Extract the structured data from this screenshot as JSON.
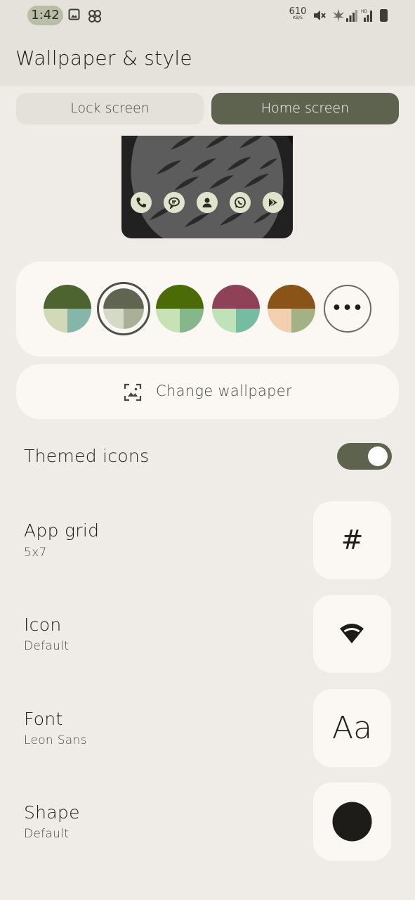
{
  "status_bar": {
    "time": "1:42",
    "net_speed_value": "610",
    "net_speed_unit": "KB/S",
    "icons": [
      "image-icon",
      "pinwheel-icon",
      "mute-icon",
      "cannabis-icon",
      "signal-icon",
      "hd-signal-icon",
      "battery-icon"
    ]
  },
  "header": {
    "title": "Wallpaper & style"
  },
  "tabs": [
    {
      "label": "Lock screen",
      "selected": false
    },
    {
      "label": "Home screen",
      "selected": true
    }
  ],
  "preview": {
    "dock_icons": [
      "phone-icon",
      "messages-icon",
      "contacts-icon",
      "whatsapp-icon",
      "play-store-icon"
    ]
  },
  "color_options": [
    {
      "top": "#4e6430",
      "bottom_left": "#d2d9b9",
      "bottom_right": "#86b5aa",
      "selected": false
    },
    {
      "top": "#5f6550",
      "bottom_left": "#d6d9c8",
      "bottom_right": "#a9b098",
      "selected": true
    },
    {
      "top": "#4a6b07",
      "bottom_left": "#c8e2b6",
      "bottom_right": "#86b78c",
      "selected": false
    },
    {
      "top": "#8f4257",
      "bottom_left": "#bfe2b8",
      "bottom_right": "#74bca3",
      "selected": false
    },
    {
      "top": "#8a5418",
      "bottom_left": "#f2cfae",
      "bottom_right": "#a3b185",
      "selected": false
    }
  ],
  "change_wallpaper": {
    "label": "Change wallpaper"
  },
  "themed_icons": {
    "label": "Themed icons",
    "enabled": true
  },
  "settings": {
    "app_grid": {
      "title": "App grid",
      "value": "5x7",
      "glyph": "#"
    },
    "icon": {
      "title": "Icon",
      "value": "Default"
    },
    "font": {
      "title": "Font",
      "value": "Leon Sans",
      "glyph": "Aa"
    },
    "shape": {
      "title": "Shape",
      "value": "Default"
    }
  },
  "colors": {
    "accent": "#5e6350",
    "background": "#efece7",
    "card": "#fbf8f3"
  }
}
